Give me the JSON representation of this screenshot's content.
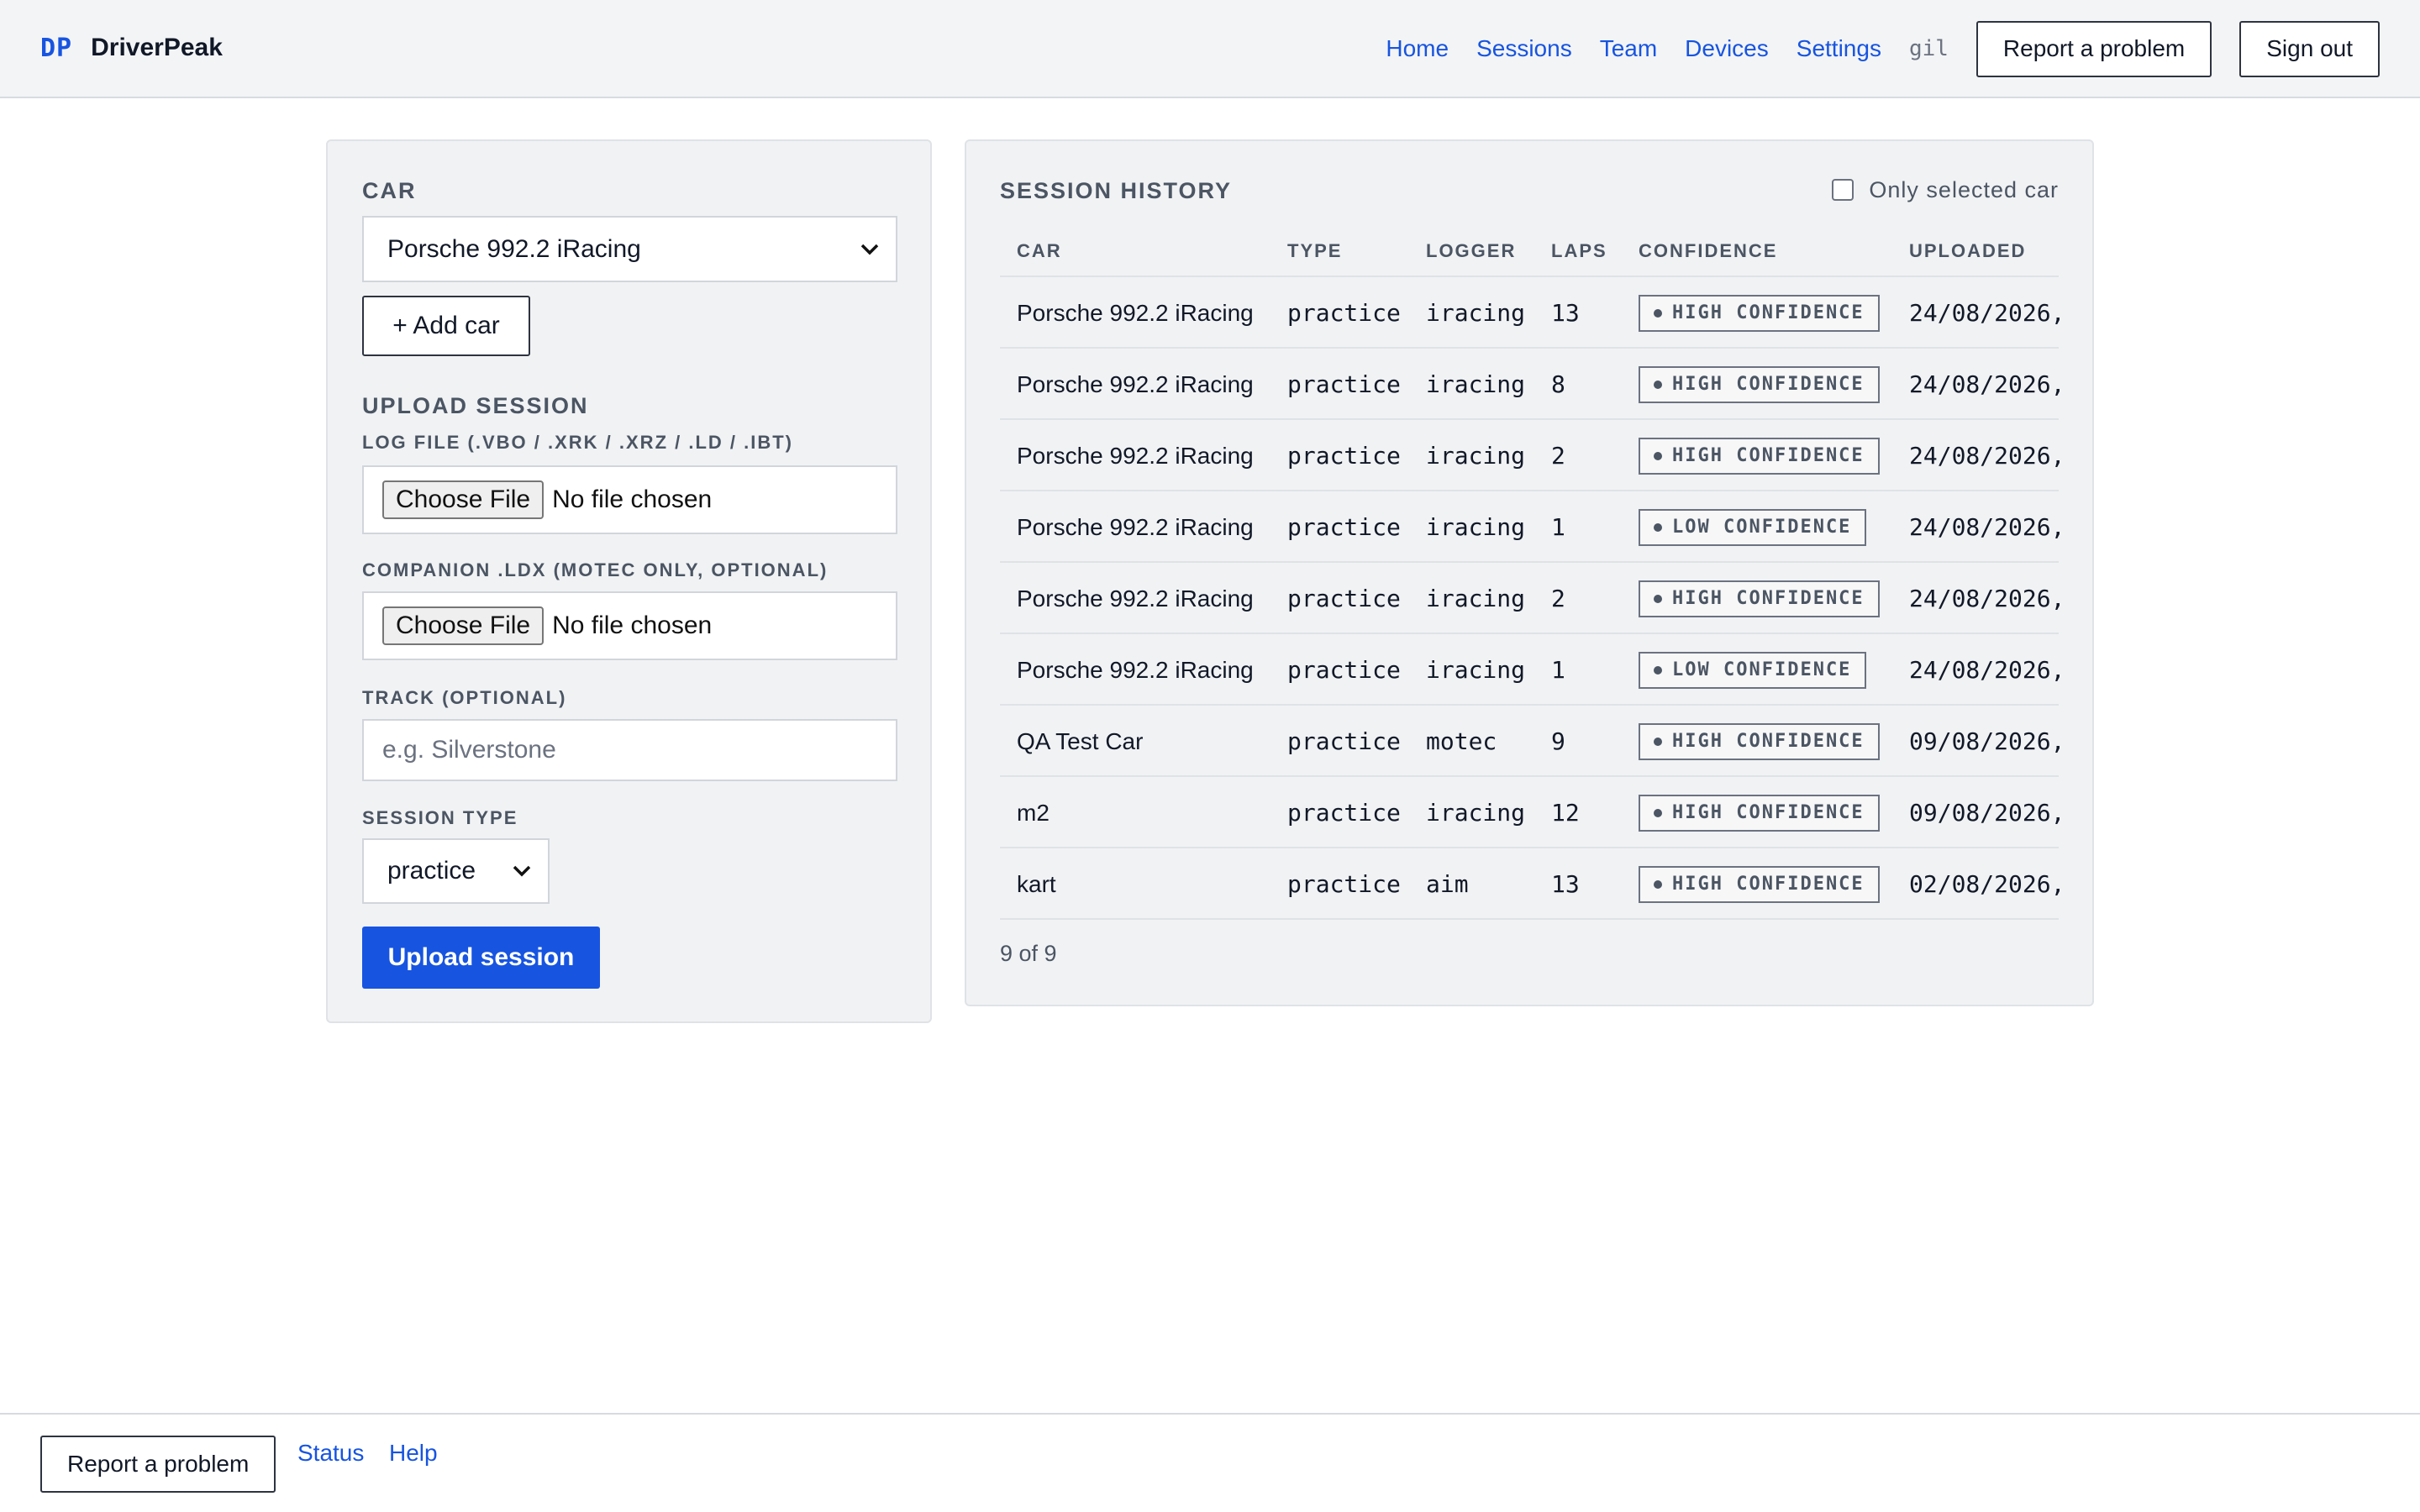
{
  "header": {
    "logo_mark": "DP",
    "brand": "DriverPeak",
    "nav": [
      "Home",
      "Sessions",
      "Team",
      "Devices",
      "Settings"
    ],
    "user": "gil",
    "report_label": "Report a problem",
    "signout_label": "Sign out"
  },
  "left": {
    "car_title": "CAR",
    "car_selected": "Porsche 992.2 iRacing",
    "add_car_label": "+ Add car",
    "upload_title": "UPLOAD SESSION",
    "log_label": "LOG FILE (.VBO / .XRK / .XRZ / .LD / .IBT)",
    "choose_file": "Choose File",
    "no_file": "No file chosen",
    "ldx_label": "COMPANION .LDX (MOTEC ONLY, OPTIONAL)",
    "track_label": "TRACK (OPTIONAL)",
    "track_placeholder": "e.g. Silverstone",
    "session_type_label": "SESSION TYPE",
    "session_type_selected": "practice",
    "upload_button": "Upload session"
  },
  "history": {
    "title": "SESSION HISTORY",
    "filter_label": "Only selected car",
    "columns": [
      "CAR",
      "TYPE",
      "LOGGER",
      "LAPS",
      "CONFIDENCE",
      "UPLOADED"
    ],
    "rows": [
      {
        "car": "Porsche 992.2 iRacing",
        "type": "practice",
        "logger": "iracing",
        "laps": "13",
        "confidence": "HIGH CONFIDENCE",
        "uploaded": "24/08/2026,"
      },
      {
        "car": "Porsche 992.2 iRacing",
        "type": "practice",
        "logger": "iracing",
        "laps": "8",
        "confidence": "HIGH CONFIDENCE",
        "uploaded": "24/08/2026,"
      },
      {
        "car": "Porsche 992.2 iRacing",
        "type": "practice",
        "logger": "iracing",
        "laps": "2",
        "confidence": "HIGH CONFIDENCE",
        "uploaded": "24/08/2026,"
      },
      {
        "car": "Porsche 992.2 iRacing",
        "type": "practice",
        "logger": "iracing",
        "laps": "1",
        "confidence": "LOW CONFIDENCE",
        "uploaded": "24/08/2026,"
      },
      {
        "car": "Porsche 992.2 iRacing",
        "type": "practice",
        "logger": "iracing",
        "laps": "2",
        "confidence": "HIGH CONFIDENCE",
        "uploaded": "24/08/2026,"
      },
      {
        "car": "Porsche 992.2 iRacing",
        "type": "practice",
        "logger": "iracing",
        "laps": "1",
        "confidence": "LOW CONFIDENCE",
        "uploaded": "24/08/2026,"
      },
      {
        "car": "QA Test Car",
        "type": "practice",
        "logger": "motec",
        "laps": "9",
        "confidence": "HIGH CONFIDENCE",
        "uploaded": "09/08/2026,"
      },
      {
        "car": "m2",
        "type": "practice",
        "logger": "iracing",
        "laps": "12",
        "confidence": "HIGH CONFIDENCE",
        "uploaded": "09/08/2026,"
      },
      {
        "car": "kart",
        "type": "practice",
        "logger": "aim",
        "laps": "13",
        "confidence": "HIGH CONFIDENCE",
        "uploaded": "02/08/2026,"
      }
    ],
    "count": "9 of 9"
  },
  "footer": {
    "report_label": "Report a problem",
    "links": [
      "Status",
      "Help"
    ]
  },
  "colors": {
    "accent": "#1754e0",
    "panel_bg": "#f1f2f4",
    "muted_text": "#4b5563"
  }
}
